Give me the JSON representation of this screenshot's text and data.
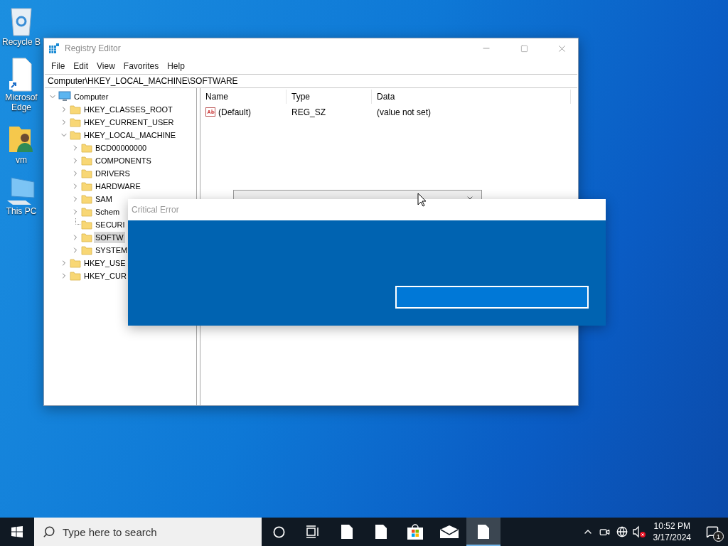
{
  "desktop_icons": [
    {
      "kind": "recycle-bin",
      "lines": [
        "Recycle B"
      ]
    },
    {
      "kind": "shortcut-file",
      "lines": [
        "Microsof",
        "Edge"
      ]
    },
    {
      "kind": "user-folder",
      "lines": [
        "vm"
      ]
    },
    {
      "kind": "computer",
      "lines": [
        "This PC"
      ]
    }
  ],
  "registry_editor": {
    "title": "Registry Editor",
    "menu": [
      "File",
      "Edit",
      "View",
      "Favorites",
      "Help"
    ],
    "address": "Computer\\HKEY_LOCAL_MACHINE\\SOFTWARE",
    "tree": [
      {
        "label": "Computer",
        "kind": "computer",
        "expandable": true,
        "expanded": true,
        "selected": false,
        "children": [
          {
            "label": "HKEY_CLASSES_ROOT",
            "kind": "folder",
            "expandable": true,
            "selected": false
          },
          {
            "label": "HKEY_CURRENT_USER",
            "kind": "folder",
            "expandable": true,
            "selected": false
          },
          {
            "label": "HKEY_LOCAL_MACHINE",
            "kind": "folder",
            "expandable": true,
            "expanded": true,
            "selected": false,
            "children": [
              {
                "label": "BCD00000000",
                "kind": "folder",
                "expandable": true,
                "selected": false
              },
              {
                "label": "COMPONENTS",
                "kind": "folder",
                "expandable": true,
                "selected": false
              },
              {
                "label": "DRIVERS",
                "kind": "folder",
                "expandable": true,
                "selected": false
              },
              {
                "label": "HARDWARE",
                "kind": "folder",
                "expandable": true,
                "selected": false
              },
              {
                "label": "SAM",
                "kind": "folder",
                "expandable": true,
                "selected": false
              },
              {
                "label": "Schem",
                "kind": "folder",
                "expandable": true,
                "selected": false
              },
              {
                "label": "SECURI",
                "kind": "folder",
                "expandable": false,
                "selected": false
              },
              {
                "label": "SOFTW",
                "kind": "folder",
                "expandable": true,
                "selected": true
              },
              {
                "label": "SYSTEM",
                "kind": "folder",
                "expandable": true,
                "selected": false
              }
            ]
          },
          {
            "label": "HKEY_USE",
            "kind": "folder",
            "expandable": true,
            "selected": false
          },
          {
            "label": "HKEY_CUR",
            "kind": "folder",
            "expandable": true,
            "selected": false
          }
        ]
      }
    ],
    "columns": [
      "Name",
      "Type",
      "Data"
    ],
    "rows": [
      {
        "name": "(Default)",
        "type": "REG_SZ",
        "data": "(value not set)"
      }
    ]
  },
  "error_dialog": {
    "title": "Critical Error"
  },
  "taskbar": {
    "search_placeholder": "Type here to search",
    "apps": [
      {
        "kind": "cortana",
        "selected": false
      },
      {
        "kind": "task-view",
        "selected": false
      },
      {
        "kind": "file",
        "selected": false
      },
      {
        "kind": "file",
        "selected": false
      },
      {
        "kind": "store",
        "selected": false
      },
      {
        "kind": "mail",
        "selected": false
      },
      {
        "kind": "file",
        "selected": true
      }
    ],
    "volume_muted": true,
    "time": "10:52 PM",
    "date": "3/17/2024",
    "notification_count": "1"
  }
}
